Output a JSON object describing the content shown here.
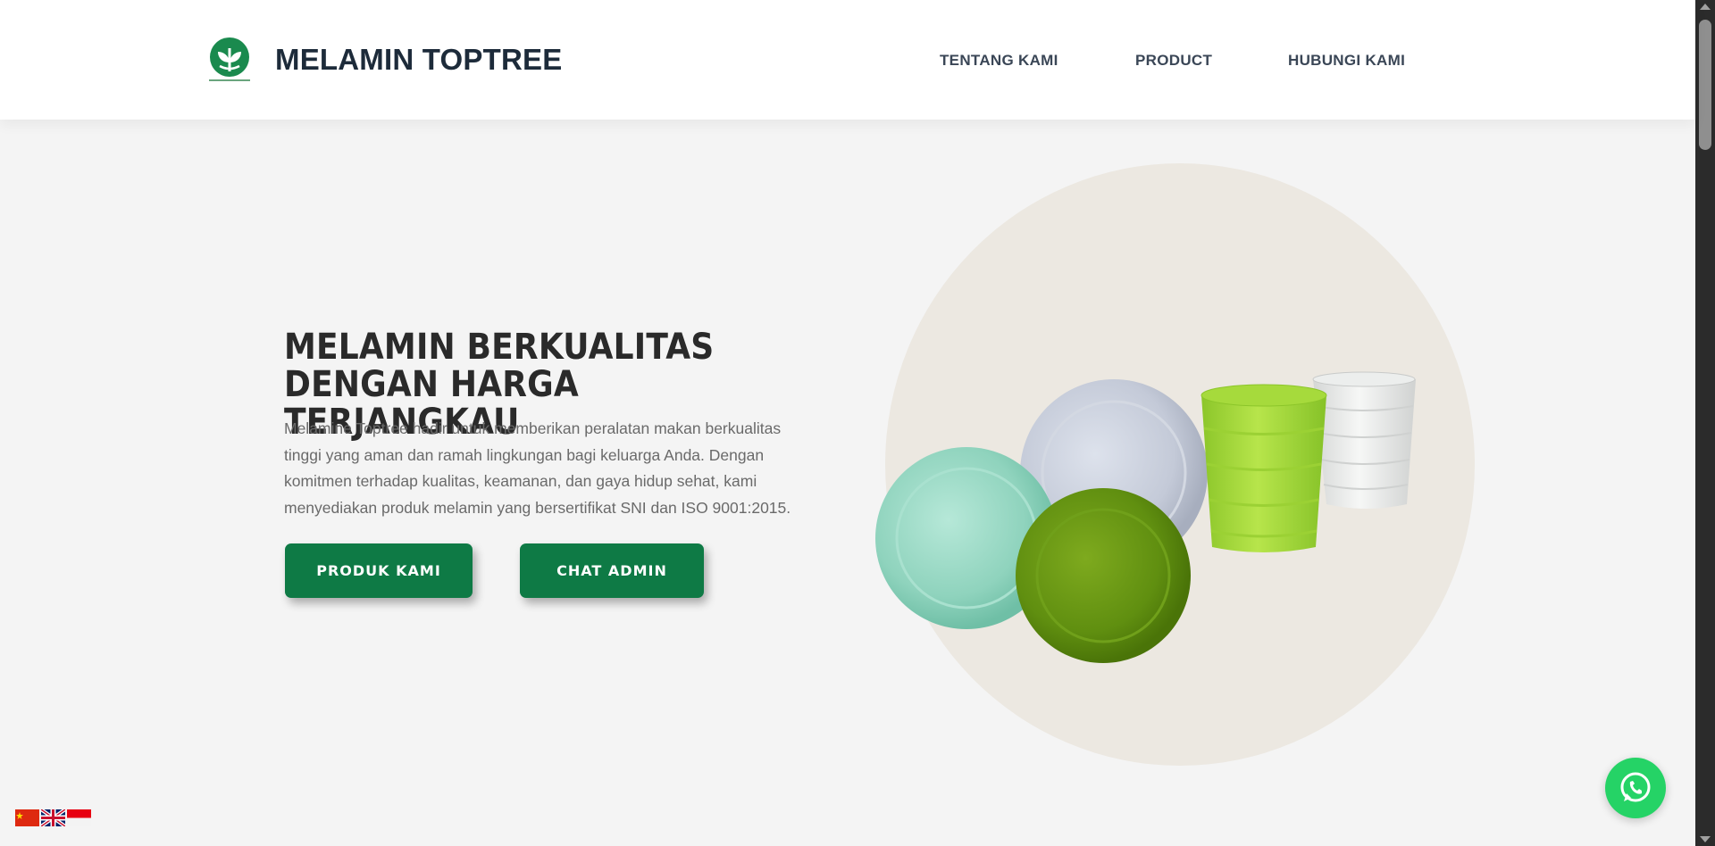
{
  "header": {
    "brand": "MELAMIN TOPTREE",
    "logo_icon": "plant-leaf-logo-icon",
    "nav": [
      "TENTANG KAMI",
      "PRODUCT",
      "HUBUNGI KAMI"
    ]
  },
  "hero": {
    "title_line1": "MELAMIN BERKUALITAS",
    "title_line2": "DENGAN HARGA TERJANGKAU",
    "description": "Melamine Toptree hadir untuk memberikan peralatan makan berkualitas tinggi yang aman dan ramah lingkungan bagi keluarga Anda. Dengan komitmen terhadap kualitas, keamanan, dan gaya hidup sehat, kami menyediakan produk melamin yang bersertifikat SNI dan ISO 9001:2015.",
    "buttons": [
      "PRODUK KAMI",
      "CHAT ADMIN"
    ]
  },
  "floating": {
    "whatsapp_icon": "whatsapp-icon",
    "languages": [
      "Chinese",
      "English",
      "Indonesian"
    ]
  },
  "colors": {
    "brand_green": "#0e7a45",
    "whatsapp_green": "#25d366",
    "circle_bg": "#ece8e1",
    "page_bg": "#f4f4f4"
  }
}
